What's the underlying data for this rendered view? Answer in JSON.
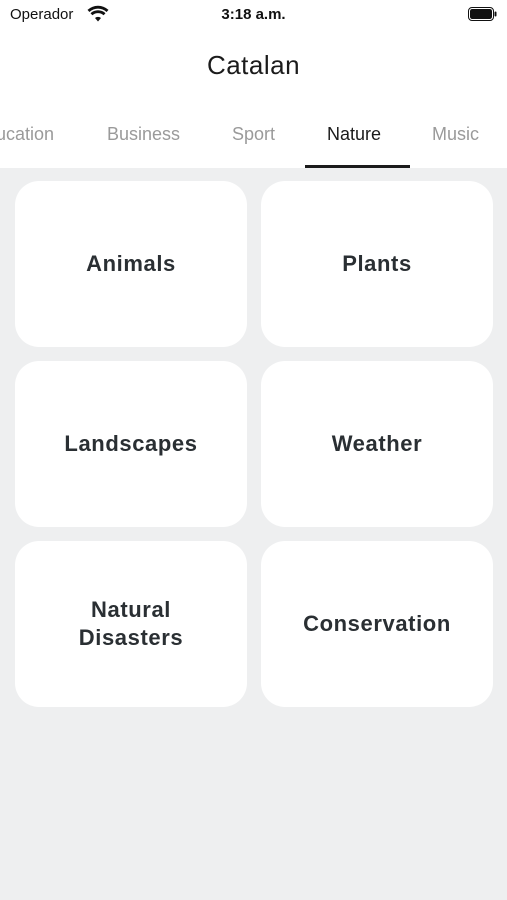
{
  "status_bar": {
    "carrier": "Operador",
    "time": "3:18 a.m.",
    "wifi_icon": "wifi-icon",
    "battery_icon": "battery-icon"
  },
  "header": {
    "title": "Catalan"
  },
  "tabs": [
    {
      "label": "ucation",
      "active": false
    },
    {
      "label": "Business",
      "active": false
    },
    {
      "label": "Sport",
      "active": false
    },
    {
      "label": "Nature",
      "active": true
    },
    {
      "label": "Music",
      "active": false
    }
  ],
  "categories": [
    {
      "label": "Animals"
    },
    {
      "label": "Plants"
    },
    {
      "label": "Landscapes"
    },
    {
      "label": "Weather"
    },
    {
      "label": "Natural\nDisasters"
    },
    {
      "label": "Conservation"
    }
  ],
  "colors": {
    "background": "#eeeff0",
    "card": "#ffffff",
    "active_tab": "#1b1b1b",
    "inactive_tab": "#9a9a9a"
  }
}
